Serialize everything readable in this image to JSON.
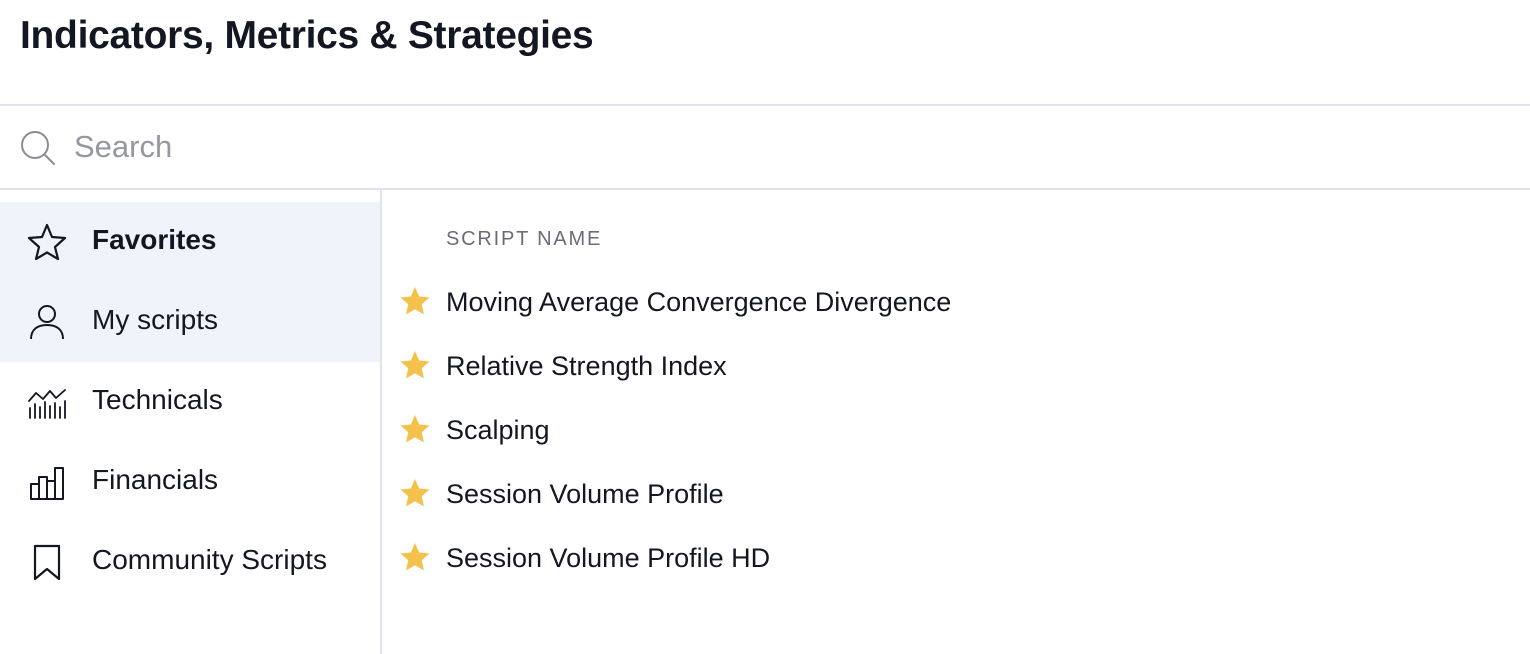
{
  "header": {
    "title": "Indicators, Metrics & Strategies"
  },
  "search": {
    "placeholder": "Search",
    "value": ""
  },
  "sidebar": {
    "items": [
      {
        "label": "Favorites",
        "icon": "star-outline-icon",
        "selected": true
      },
      {
        "label": "My scripts",
        "icon": "user-icon",
        "selected": false
      },
      {
        "label": "Technicals",
        "icon": "technicals-chart-icon",
        "selected": false
      },
      {
        "label": "Financials",
        "icon": "bar-chart-icon",
        "selected": false
      },
      {
        "label": "Community Scripts",
        "icon": "bookmark-icon",
        "selected": false
      }
    ]
  },
  "list": {
    "column_header": "SCRIPT NAME",
    "rows": [
      {
        "name": "Moving Average Convergence Divergence",
        "favorite": true
      },
      {
        "name": "Relative Strength Index",
        "favorite": true
      },
      {
        "name": "Scalping",
        "favorite": true
      },
      {
        "name": "Session Volume Profile",
        "favorite": true
      },
      {
        "name": "Session Volume Profile HD",
        "favorite": true
      }
    ]
  },
  "colors": {
    "text": "#131722",
    "muted": "#9598a1",
    "header_muted": "#6a6d78",
    "divider": "#e0e3eb",
    "highlight": "#f0f3fa",
    "star": "#f5c14d"
  }
}
